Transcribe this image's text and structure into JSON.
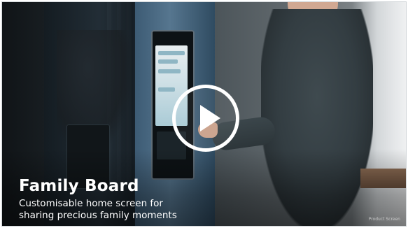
{
  "video": {
    "title": "Family Board",
    "subtitle_line1": "Customisable home screen for",
    "subtitle_line2": "sharing precious family moments",
    "watermark": "Product Screen"
  },
  "controls": {
    "play_icon": "play-icon"
  },
  "colors": {
    "caption_text": "#ffffff",
    "play_button": "#ffffff",
    "frame_border": "#cfd3d6"
  }
}
